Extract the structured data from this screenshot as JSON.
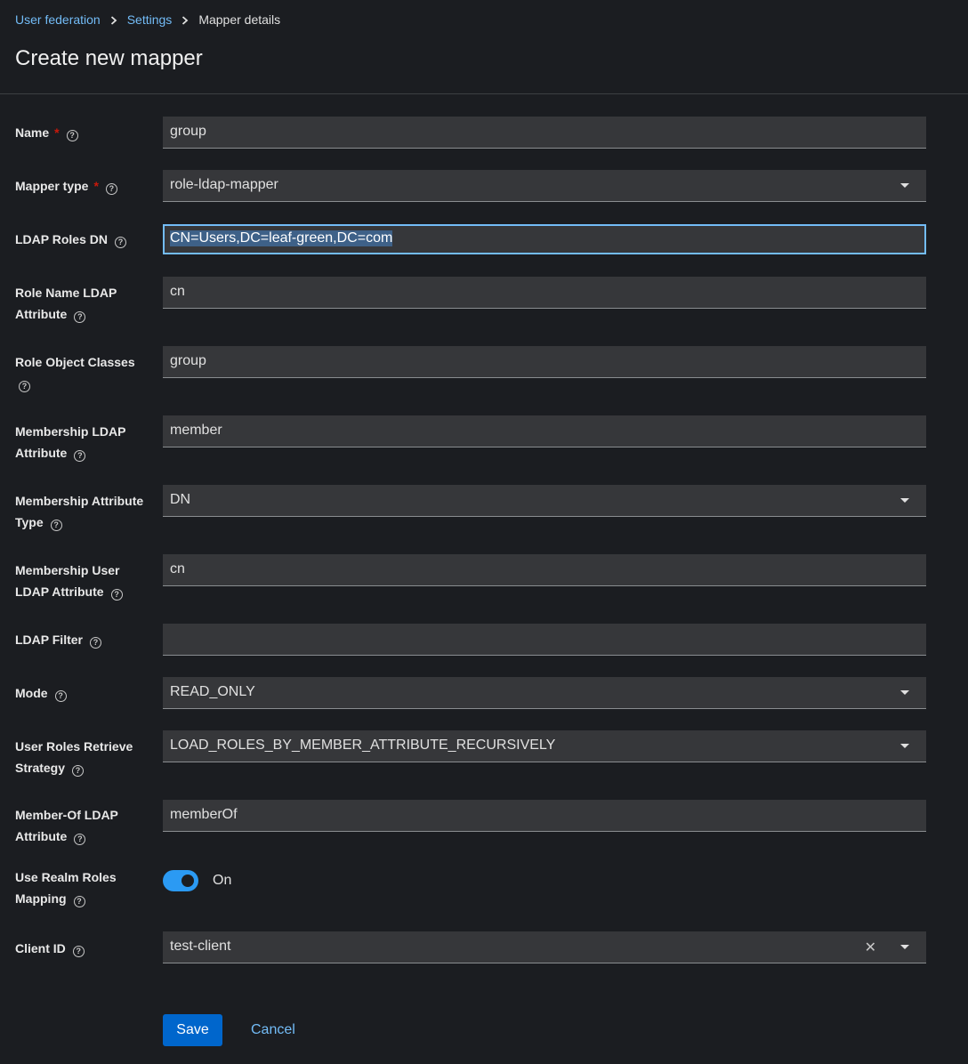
{
  "breadcrumb": {
    "items": [
      "User federation",
      "Settings"
    ],
    "current": "Mapper details"
  },
  "page_title": "Create new mapper",
  "fields": {
    "name": {
      "label": "Name",
      "required_mark": "*",
      "value": "group"
    },
    "mapper_type": {
      "label": "Mapper type",
      "required_mark": "*",
      "value": "role-ldap-mapper"
    },
    "ldap_roles_dn": {
      "label": "LDAP Roles DN",
      "value": "CN=Users,DC=leaf-green,DC=com"
    },
    "role_name_attr": {
      "label_line1": "Role Name LDAP",
      "label_line2": "Attribute",
      "value": "cn"
    },
    "role_object_classes": {
      "label_line1": "Role Object Classes",
      "value": "group"
    },
    "membership_attr": {
      "label_line1": "Membership LDAP",
      "label_line2": "Attribute",
      "value": "member"
    },
    "membership_attr_type": {
      "label_line1": "Membership Attribute",
      "label_line2": "Type",
      "value": "DN"
    },
    "membership_user_attr": {
      "label_line1": "Membership User",
      "label_line2": "LDAP Attribute",
      "value": "cn"
    },
    "ldap_filter": {
      "label": "LDAP Filter",
      "value": ""
    },
    "mode": {
      "label": "Mode",
      "value": "READ_ONLY"
    },
    "retrieve_strategy": {
      "label_line1": "User Roles Retrieve",
      "label_line2": "Strategy",
      "value": "LOAD_ROLES_BY_MEMBER_ATTRIBUTE_RECURSIVELY"
    },
    "member_of_attr": {
      "label_line1": "Member-Of LDAP",
      "label_line2": "Attribute",
      "value": "memberOf"
    },
    "use_realm_roles": {
      "label_line1": "Use Realm Roles",
      "label_line2": "Mapping",
      "state": "On"
    },
    "client_id": {
      "label": "Client ID",
      "value": "test-client",
      "clear_glyph": "✕"
    }
  },
  "help_glyph": "?",
  "actions": {
    "save": "Save",
    "cancel": "Cancel"
  },
  "colors": {
    "background": "#1b1d21",
    "input": "#36373a",
    "link": "#73bcf7",
    "primary": "#0066cc",
    "toggle_on": "#2b9af3",
    "required": "#c9190b"
  }
}
